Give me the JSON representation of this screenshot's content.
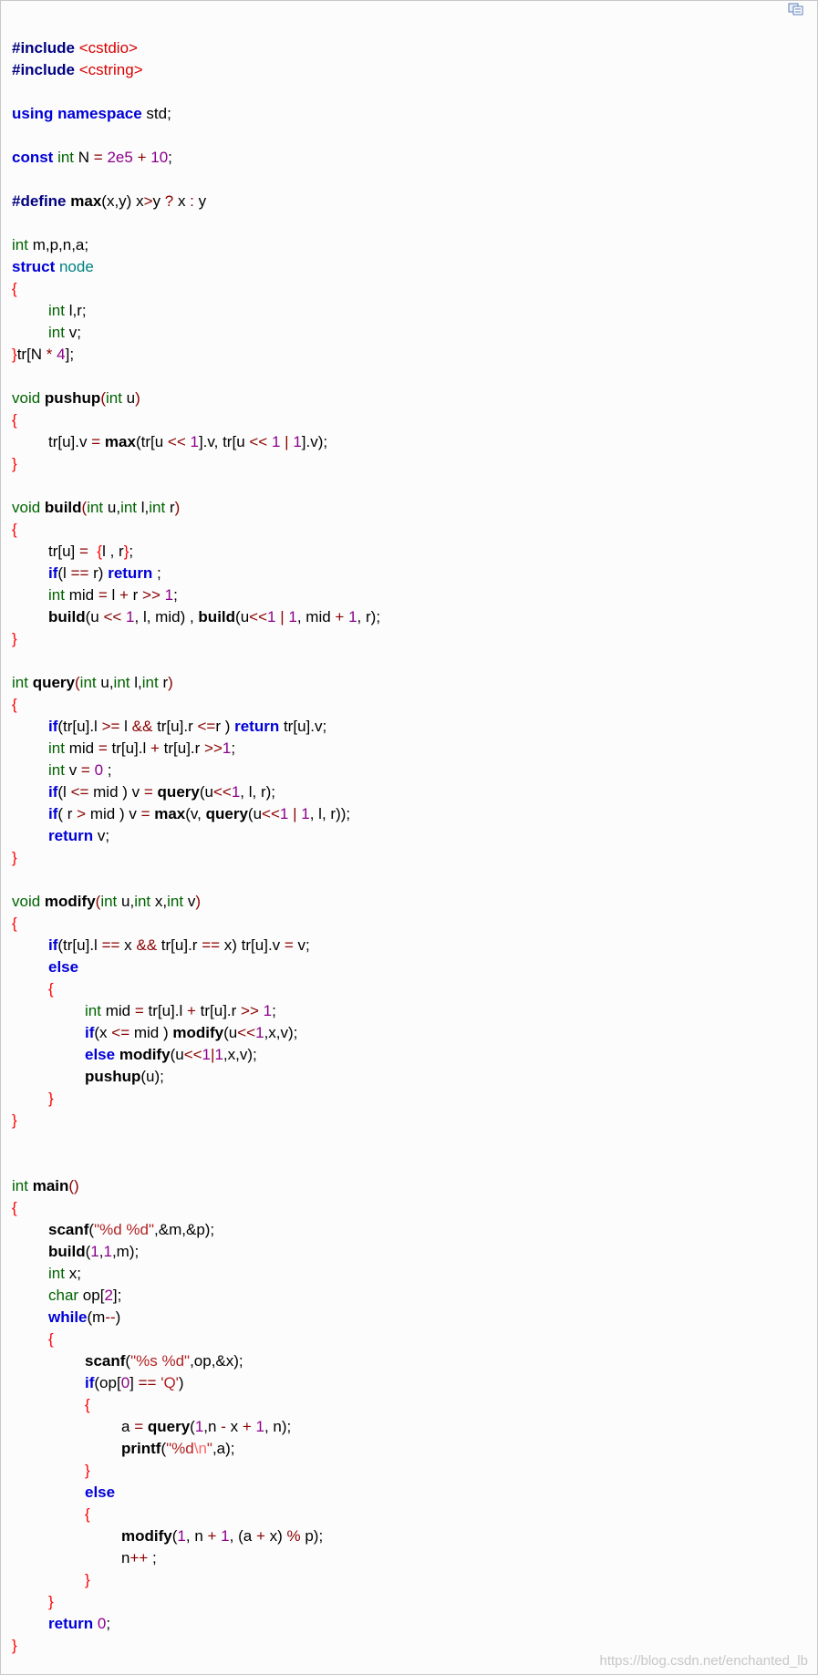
{
  "toolbar": {
    "copy_icon": "copy-icon"
  },
  "colors": {
    "preprocessor": "#000080",
    "include_path": "#d90000",
    "keyword": "#0000d8",
    "type": "#006400",
    "number": "#8b008b",
    "operator": "#8b0000",
    "function": "#000000",
    "class_name": "#008080",
    "string": "#b22222",
    "escape": "#ff6666",
    "brace": "#ff0000"
  },
  "code_lines": [
    [
      [
        "pre",
        "#include"
      ],
      [
        "plain",
        " "
      ],
      [
        "inc",
        "<cstdio>"
      ]
    ],
    [
      [
        "pre",
        "#include"
      ],
      [
        "plain",
        " "
      ],
      [
        "inc",
        "<cstring>"
      ]
    ],
    [],
    [
      [
        "kw",
        "using"
      ],
      [
        "plain",
        " "
      ],
      [
        "kw",
        "namespace"
      ],
      [
        "plain",
        " std;"
      ]
    ],
    [],
    [
      [
        "kw",
        "const"
      ],
      [
        "plain",
        " "
      ],
      [
        "type",
        "int"
      ],
      [
        "plain",
        " N "
      ],
      [
        "op",
        "="
      ],
      [
        "plain",
        " "
      ],
      [
        "num",
        "2e5"
      ],
      [
        "plain",
        " "
      ],
      [
        "op",
        "+"
      ],
      [
        "plain",
        " "
      ],
      [
        "num",
        "10"
      ],
      [
        "plain",
        ";"
      ]
    ],
    [],
    [
      [
        "pre",
        "#define"
      ],
      [
        "plain",
        " "
      ],
      [
        "fn",
        "max"
      ],
      [
        "plain",
        "(x,y) x"
      ],
      [
        "op",
        ">"
      ],
      [
        "plain",
        "y "
      ],
      [
        "op",
        "?"
      ],
      [
        "plain",
        " x "
      ],
      [
        "op",
        ":"
      ],
      [
        "plain",
        " y"
      ]
    ],
    [],
    [
      [
        "type",
        "int"
      ],
      [
        "plain",
        " m,p,n,a;"
      ]
    ],
    [
      [
        "kw",
        "struct"
      ],
      [
        "plain",
        " "
      ],
      [
        "cls",
        "node"
      ]
    ],
    [
      [
        "brace",
        "{"
      ]
    ],
    [
      [
        "plain",
        "\t"
      ],
      [
        "type",
        "int"
      ],
      [
        "plain",
        " l,r;"
      ]
    ],
    [
      [
        "plain",
        "\t"
      ],
      [
        "type",
        "int"
      ],
      [
        "plain",
        " v;"
      ]
    ],
    [
      [
        "brace",
        "}"
      ],
      [
        "plain",
        "tr[N "
      ],
      [
        "op",
        "*"
      ],
      [
        "plain",
        " "
      ],
      [
        "num",
        "4"
      ],
      [
        "plain",
        "];"
      ]
    ],
    [],
    [
      [
        "type",
        "void"
      ],
      [
        "plain",
        " "
      ],
      [
        "fn",
        "pushup"
      ],
      [
        "op",
        "("
      ],
      [
        "type",
        "int"
      ],
      [
        "plain",
        " u"
      ],
      [
        "op",
        ")"
      ]
    ],
    [
      [
        "brace",
        "{"
      ]
    ],
    [
      [
        "plain",
        "\ttr[u].v "
      ],
      [
        "op",
        "="
      ],
      [
        "plain",
        " "
      ],
      [
        "fn",
        "max"
      ],
      [
        "plain",
        "(tr[u "
      ],
      [
        "op",
        "<<"
      ],
      [
        "plain",
        " "
      ],
      [
        "num",
        "1"
      ],
      [
        "plain",
        "].v, tr[u "
      ],
      [
        "op",
        "<<"
      ],
      [
        "plain",
        " "
      ],
      [
        "num",
        "1"
      ],
      [
        "plain",
        " "
      ],
      [
        "op",
        "|"
      ],
      [
        "plain",
        " "
      ],
      [
        "num",
        "1"
      ],
      [
        "plain",
        "].v);"
      ]
    ],
    [
      [
        "brace",
        "}"
      ]
    ],
    [],
    [
      [
        "type",
        "void"
      ],
      [
        "plain",
        " "
      ],
      [
        "fn",
        "build"
      ],
      [
        "op",
        "("
      ],
      [
        "type",
        "int"
      ],
      [
        "plain",
        " u,"
      ],
      [
        "type",
        "int"
      ],
      [
        "plain",
        " l,"
      ],
      [
        "type",
        "int"
      ],
      [
        "plain",
        " r"
      ],
      [
        "op",
        ")"
      ]
    ],
    [
      [
        "brace",
        "{"
      ]
    ],
    [
      [
        "plain",
        "\ttr[u] "
      ],
      [
        "op",
        "="
      ],
      [
        "plain",
        "  "
      ],
      [
        "brace",
        "{"
      ],
      [
        "plain",
        "l , r"
      ],
      [
        "brace",
        "}"
      ],
      [
        "plain",
        ";"
      ]
    ],
    [
      [
        "plain",
        "\t"
      ],
      [
        "kw",
        "if"
      ],
      [
        "plain",
        "(l "
      ],
      [
        "op",
        "=="
      ],
      [
        "plain",
        " r) "
      ],
      [
        "kw",
        "return"
      ],
      [
        "plain",
        " ;"
      ]
    ],
    [
      [
        "plain",
        "\t"
      ],
      [
        "type",
        "int"
      ],
      [
        "plain",
        " mid "
      ],
      [
        "op",
        "="
      ],
      [
        "plain",
        " l "
      ],
      [
        "op",
        "+"
      ],
      [
        "plain",
        " r "
      ],
      [
        "op",
        ">>"
      ],
      [
        "plain",
        " "
      ],
      [
        "num",
        "1"
      ],
      [
        "plain",
        ";"
      ]
    ],
    [
      [
        "plain",
        "\t"
      ],
      [
        "fn",
        "build"
      ],
      [
        "plain",
        "(u "
      ],
      [
        "op",
        "<<"
      ],
      [
        "plain",
        " "
      ],
      [
        "num",
        "1"
      ],
      [
        "plain",
        ", l, mid) , "
      ],
      [
        "fn",
        "build"
      ],
      [
        "plain",
        "(u"
      ],
      [
        "op",
        "<<"
      ],
      [
        "num",
        "1"
      ],
      [
        "plain",
        " "
      ],
      [
        "op",
        "|"
      ],
      [
        "plain",
        " "
      ],
      [
        "num",
        "1"
      ],
      [
        "plain",
        ", mid "
      ],
      [
        "op",
        "+"
      ],
      [
        "plain",
        " "
      ],
      [
        "num",
        "1"
      ],
      [
        "plain",
        ", r);"
      ]
    ],
    [
      [
        "brace",
        "}"
      ]
    ],
    [],
    [
      [
        "type",
        "int"
      ],
      [
        "plain",
        " "
      ],
      [
        "fn",
        "query"
      ],
      [
        "op",
        "("
      ],
      [
        "type",
        "int"
      ],
      [
        "plain",
        " u,"
      ],
      [
        "type",
        "int"
      ],
      [
        "plain",
        " l,"
      ],
      [
        "type",
        "int"
      ],
      [
        "plain",
        " r"
      ],
      [
        "op",
        ")"
      ]
    ],
    [
      [
        "brace",
        "{"
      ]
    ],
    [
      [
        "plain",
        "\t"
      ],
      [
        "kw",
        "if"
      ],
      [
        "plain",
        "(tr[u].l "
      ],
      [
        "op",
        ">="
      ],
      [
        "plain",
        " l "
      ],
      [
        "op",
        "&&"
      ],
      [
        "plain",
        " tr[u].r "
      ],
      [
        "op",
        "<="
      ],
      [
        "plain",
        "r ) "
      ],
      [
        "kw",
        "return"
      ],
      [
        "plain",
        " tr[u].v;"
      ]
    ],
    [
      [
        "plain",
        "\t"
      ],
      [
        "type",
        "int"
      ],
      [
        "plain",
        " mid "
      ],
      [
        "op",
        "="
      ],
      [
        "plain",
        " tr[u].l "
      ],
      [
        "op",
        "+"
      ],
      [
        "plain",
        " tr[u].r "
      ],
      [
        "op",
        ">>"
      ],
      [
        "num",
        "1"
      ],
      [
        "plain",
        ";"
      ]
    ],
    [
      [
        "plain",
        "\t"
      ],
      [
        "type",
        "int"
      ],
      [
        "plain",
        " v "
      ],
      [
        "op",
        "="
      ],
      [
        "plain",
        " "
      ],
      [
        "num",
        "0"
      ],
      [
        "plain",
        " ;"
      ]
    ],
    [
      [
        "plain",
        "\t"
      ],
      [
        "kw",
        "if"
      ],
      [
        "plain",
        "(l "
      ],
      [
        "op",
        "<="
      ],
      [
        "plain",
        " mid ) v "
      ],
      [
        "op",
        "="
      ],
      [
        "plain",
        " "
      ],
      [
        "fn",
        "query"
      ],
      [
        "plain",
        "(u"
      ],
      [
        "op",
        "<<"
      ],
      [
        "num",
        "1"
      ],
      [
        "plain",
        ", l, r);"
      ]
    ],
    [
      [
        "plain",
        "\t"
      ],
      [
        "kw",
        "if"
      ],
      [
        "plain",
        "( r "
      ],
      [
        "op",
        ">"
      ],
      [
        "plain",
        " mid ) v "
      ],
      [
        "op",
        "="
      ],
      [
        "plain",
        " "
      ],
      [
        "fn",
        "max"
      ],
      [
        "plain",
        "(v, "
      ],
      [
        "fn",
        "query"
      ],
      [
        "plain",
        "(u"
      ],
      [
        "op",
        "<<"
      ],
      [
        "num",
        "1"
      ],
      [
        "plain",
        " "
      ],
      [
        "op",
        "|"
      ],
      [
        "plain",
        " "
      ],
      [
        "num",
        "1"
      ],
      [
        "plain",
        ", l, r));"
      ]
    ],
    [
      [
        "plain",
        "\t"
      ],
      [
        "kw",
        "return"
      ],
      [
        "plain",
        " v;"
      ]
    ],
    [
      [
        "brace",
        "}"
      ]
    ],
    [],
    [
      [
        "type",
        "void"
      ],
      [
        "plain",
        " "
      ],
      [
        "fn",
        "modify"
      ],
      [
        "op",
        "("
      ],
      [
        "type",
        "int"
      ],
      [
        "plain",
        " u,"
      ],
      [
        "type",
        "int"
      ],
      [
        "plain",
        " x,"
      ],
      [
        "type",
        "int"
      ],
      [
        "plain",
        " v"
      ],
      [
        "op",
        ")"
      ]
    ],
    [
      [
        "brace",
        "{"
      ]
    ],
    [
      [
        "plain",
        "\t"
      ],
      [
        "kw",
        "if"
      ],
      [
        "plain",
        "(tr[u].l "
      ],
      [
        "op",
        "=="
      ],
      [
        "plain",
        " x "
      ],
      [
        "op",
        "&&"
      ],
      [
        "plain",
        " tr[u].r "
      ],
      [
        "op",
        "=="
      ],
      [
        "plain",
        " x) tr[u].v "
      ],
      [
        "op",
        "="
      ],
      [
        "plain",
        " v;"
      ]
    ],
    [
      [
        "plain",
        "\t"
      ],
      [
        "kw",
        "else"
      ]
    ],
    [
      [
        "plain",
        "\t"
      ],
      [
        "brace",
        "{"
      ]
    ],
    [
      [
        "plain",
        "\t\t"
      ],
      [
        "type",
        "int"
      ],
      [
        "plain",
        " mid "
      ],
      [
        "op",
        "="
      ],
      [
        "plain",
        " tr[u].l "
      ],
      [
        "op",
        "+"
      ],
      [
        "plain",
        " tr[u].r "
      ],
      [
        "op",
        ">>"
      ],
      [
        "plain",
        " "
      ],
      [
        "num",
        "1"
      ],
      [
        "plain",
        ";"
      ]
    ],
    [
      [
        "plain",
        "\t\t"
      ],
      [
        "kw",
        "if"
      ],
      [
        "plain",
        "(x "
      ],
      [
        "op",
        "<="
      ],
      [
        "plain",
        " mid ) "
      ],
      [
        "fn",
        "modify"
      ],
      [
        "plain",
        "(u"
      ],
      [
        "op",
        "<<"
      ],
      [
        "num",
        "1"
      ],
      [
        "plain",
        ",x,v);"
      ]
    ],
    [
      [
        "plain",
        "\t\t"
      ],
      [
        "kw",
        "else"
      ],
      [
        "plain",
        " "
      ],
      [
        "fn",
        "modify"
      ],
      [
        "plain",
        "(u"
      ],
      [
        "op",
        "<<"
      ],
      [
        "num",
        "1"
      ],
      [
        "op",
        "|"
      ],
      [
        "num",
        "1"
      ],
      [
        "plain",
        ",x,v);"
      ]
    ],
    [
      [
        "plain",
        "\t\t"
      ],
      [
        "fn",
        "pushup"
      ],
      [
        "plain",
        "(u);"
      ]
    ],
    [
      [
        "plain",
        "\t"
      ],
      [
        "brace",
        "}"
      ]
    ],
    [
      [
        "brace",
        "}"
      ]
    ],
    [],
    [],
    [
      [
        "type",
        "int"
      ],
      [
        "plain",
        " "
      ],
      [
        "fn",
        "main"
      ],
      [
        "op",
        "()"
      ]
    ],
    [
      [
        "brace",
        "{"
      ]
    ],
    [
      [
        "plain",
        "\t"
      ],
      [
        "fn",
        "scanf"
      ],
      [
        "plain",
        "("
      ],
      [
        "str",
        "\"%d %d\""
      ],
      [
        "plain",
        ",&m,&p);"
      ]
    ],
    [
      [
        "plain",
        "\t"
      ],
      [
        "fn",
        "build"
      ],
      [
        "plain",
        "("
      ],
      [
        "num",
        "1"
      ],
      [
        "plain",
        ","
      ],
      [
        "num",
        "1"
      ],
      [
        "plain",
        ",m);"
      ]
    ],
    [
      [
        "plain",
        "\t"
      ],
      [
        "type",
        "int"
      ],
      [
        "plain",
        " x;"
      ]
    ],
    [
      [
        "plain",
        "\t"
      ],
      [
        "type",
        "char"
      ],
      [
        "plain",
        " op["
      ],
      [
        "num",
        "2"
      ],
      [
        "plain",
        "];"
      ]
    ],
    [
      [
        "plain",
        "\t"
      ],
      [
        "kw",
        "while"
      ],
      [
        "plain",
        "(m"
      ],
      [
        "op",
        "--"
      ],
      [
        "plain",
        ")"
      ]
    ],
    [
      [
        "plain",
        "\t"
      ],
      [
        "brace",
        "{"
      ]
    ],
    [
      [
        "plain",
        "\t\t"
      ],
      [
        "fn",
        "scanf"
      ],
      [
        "plain",
        "("
      ],
      [
        "str",
        "\"%s %d\""
      ],
      [
        "plain",
        ",op,&x);"
      ]
    ],
    [
      [
        "plain",
        "\t\t"
      ],
      [
        "kw",
        "if"
      ],
      [
        "plain",
        "(op["
      ],
      [
        "num",
        "0"
      ],
      [
        "plain",
        "] "
      ],
      [
        "op",
        "=="
      ],
      [
        "plain",
        " "
      ],
      [
        "str",
        "'Q'"
      ],
      [
        "plain",
        ")"
      ]
    ],
    [
      [
        "plain",
        "\t\t"
      ],
      [
        "brace",
        "{"
      ]
    ],
    [
      [
        "plain",
        "\t\t\ta "
      ],
      [
        "op",
        "="
      ],
      [
        "plain",
        " "
      ],
      [
        "fn",
        "query"
      ],
      [
        "plain",
        "("
      ],
      [
        "num",
        "1"
      ],
      [
        "plain",
        ",n "
      ],
      [
        "op",
        "-"
      ],
      [
        "plain",
        " x "
      ],
      [
        "op",
        "+"
      ],
      [
        "plain",
        " "
      ],
      [
        "num",
        "1"
      ],
      [
        "plain",
        ", n);"
      ]
    ],
    [
      [
        "plain",
        "\t\t\t"
      ],
      [
        "fn",
        "printf"
      ],
      [
        "plain",
        "("
      ],
      [
        "str",
        "\"%d"
      ],
      [
        "esc",
        "\\n"
      ],
      [
        "str",
        "\""
      ],
      [
        "plain",
        ",a);"
      ]
    ],
    [
      [
        "plain",
        "\t\t"
      ],
      [
        "brace",
        "}"
      ]
    ],
    [
      [
        "plain",
        "\t\t"
      ],
      [
        "kw",
        "else"
      ]
    ],
    [
      [
        "plain",
        "\t\t"
      ],
      [
        "brace",
        "{"
      ]
    ],
    [
      [
        "plain",
        "\t\t\t"
      ],
      [
        "fn",
        "modify"
      ],
      [
        "plain",
        "("
      ],
      [
        "num",
        "1"
      ],
      [
        "plain",
        ", n "
      ],
      [
        "op",
        "+"
      ],
      [
        "plain",
        " "
      ],
      [
        "num",
        "1"
      ],
      [
        "plain",
        ", (a "
      ],
      [
        "op",
        "+"
      ],
      [
        "plain",
        " x) "
      ],
      [
        "op",
        "%"
      ],
      [
        "plain",
        " p);"
      ]
    ],
    [
      [
        "plain",
        "\t\t\tn"
      ],
      [
        "op",
        "++"
      ],
      [
        "plain",
        " ;"
      ]
    ],
    [
      [
        "plain",
        "\t\t"
      ],
      [
        "brace",
        "}"
      ]
    ],
    [
      [
        "plain",
        "\t"
      ],
      [
        "brace",
        "}"
      ]
    ],
    [
      [
        "plain",
        "\t"
      ],
      [
        "kw",
        "return"
      ],
      [
        "plain",
        " "
      ],
      [
        "num",
        "0"
      ],
      [
        "plain",
        ";"
      ]
    ],
    [
      [
        "brace",
        "}"
      ]
    ]
  ],
  "watermark": "https://blog.csdn.net/enchanted_lb"
}
